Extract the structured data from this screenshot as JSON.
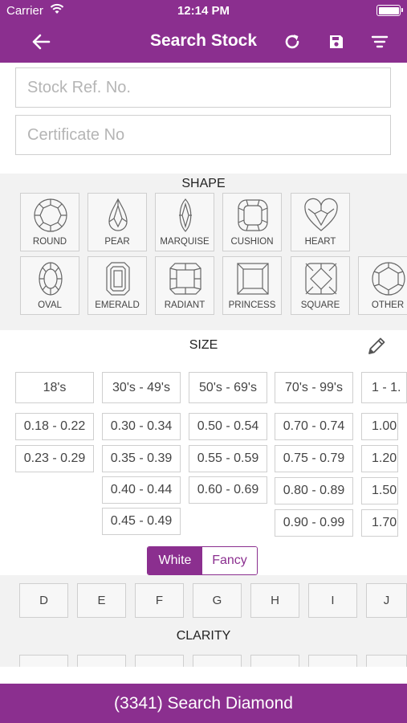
{
  "status_bar": {
    "carrier": "Carrier",
    "time": "12:14 PM"
  },
  "nav": {
    "title": "Search Stock",
    "icons": [
      "back-arrow-icon",
      "refresh-icon",
      "save-icon",
      "filter-icon"
    ]
  },
  "inputs": {
    "stock_ref": {
      "placeholder": "Stock Ref. No.",
      "value": ""
    },
    "certificate": {
      "placeholder": "Certificate No",
      "value": ""
    }
  },
  "shape": {
    "title": "SHAPE",
    "items": [
      {
        "label": "ROUND",
        "icon": "round-diamond-icon"
      },
      {
        "label": "PEAR",
        "icon": "pear-diamond-icon"
      },
      {
        "label": "MARQUISE",
        "icon": "marquise-diamond-icon"
      },
      {
        "label": "CUSHION",
        "icon": "cushion-diamond-icon"
      },
      {
        "label": "HEART",
        "icon": "heart-diamond-icon"
      },
      {
        "label": "OVAL",
        "icon": "oval-diamond-icon"
      },
      {
        "label": "EMERALD",
        "icon": "emerald-diamond-icon"
      },
      {
        "label": "RADIANT",
        "icon": "radiant-diamond-icon"
      },
      {
        "label": "PRINCESS",
        "icon": "princess-diamond-icon"
      },
      {
        "label": "SQUARE",
        "icon": "square-diamond-icon"
      },
      {
        "label": "OTHER",
        "icon": "other-diamond-icon"
      }
    ]
  },
  "size": {
    "title": "SIZE",
    "columns": [
      {
        "header": "18's",
        "ranges": [
          "0.18 - 0.22",
          "0.23 - 0.29"
        ]
      },
      {
        "header": "30's - 49's",
        "ranges": [
          "0.30 - 0.34",
          "0.35 - 0.39",
          "0.40 - 0.44",
          "0.45 - 0.49"
        ]
      },
      {
        "header": "50's - 69's",
        "ranges": [
          "0.50 - 0.54",
          "0.55 - 0.59",
          "0.60 - 0.69"
        ]
      },
      {
        "header": "70's - 99's",
        "ranges": [
          "0.70 - 0.74",
          "0.75 - 0.79",
          "0.80 - 0.89",
          "0.90 - 0.99"
        ]
      },
      {
        "header": "1 - 1.",
        "ranges": [
          "1.00",
          "1.20 -",
          "1.50",
          "1.70 -"
        ]
      }
    ]
  },
  "color_toggle": {
    "white": "White",
    "fancy": "Fancy",
    "selected": "White"
  },
  "colors": [
    "D",
    "E",
    "F",
    "G",
    "H",
    "I",
    "J"
  ],
  "clarity": {
    "title": "CLARITY"
  },
  "search_button": {
    "label": "(3341) Search Diamond"
  },
  "theme": {
    "primary": "#8b2f8f",
    "section_bg": "#f2f2f2",
    "border": "#cfcfcf"
  }
}
